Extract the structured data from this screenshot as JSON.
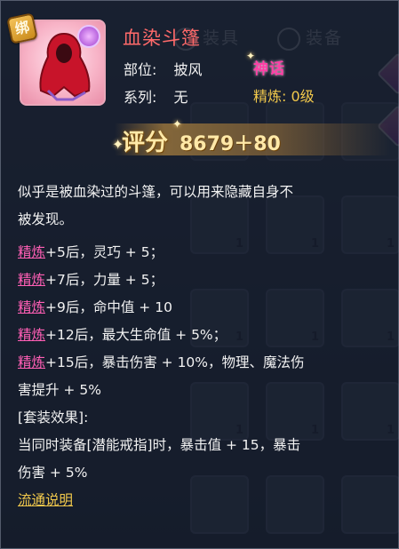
{
  "item": {
    "bind_label": "绑",
    "name": "血染斗篷",
    "slot_label": "部位:",
    "slot_value": "披风",
    "series_label": "系列:",
    "series_value": "无",
    "rarity": "神话",
    "refine_label": "精炼: 0级",
    "score_label": "评分",
    "score_value": "8679＋80"
  },
  "description": {
    "flavor_line1": "似乎是被血染过的斗篷，可以用来隐藏自身不",
    "flavor_line2": "被发现。",
    "refine_word": "精炼",
    "bonuses": [
      "+5后，灵巧 + 5；",
      "+7后，力量 + 5；",
      "+9后，命中值 + 10",
      "+12后，最大生命值 + 5%；",
      "+15后，暴击伤害 + 10%，物理、魔法伤"
    ],
    "bonus5_line2": "害提升 + 5%",
    "set_header": "[套装效果]:",
    "set_line1": "当同时装备[潜能戒指]时，暴击值 + 15，暴击",
    "set_line2": "伤害 + 5%",
    "circulation_link": "流通说明"
  },
  "background": {
    "tab_gear": "装具",
    "tab_equip": "装备",
    "slot_count": "1"
  },
  "colors": {
    "item_name": "#ff6a6a",
    "rarity": "#ff3fa6",
    "refine": "#f2c94c",
    "link_pink": "#ff5fb5"
  }
}
